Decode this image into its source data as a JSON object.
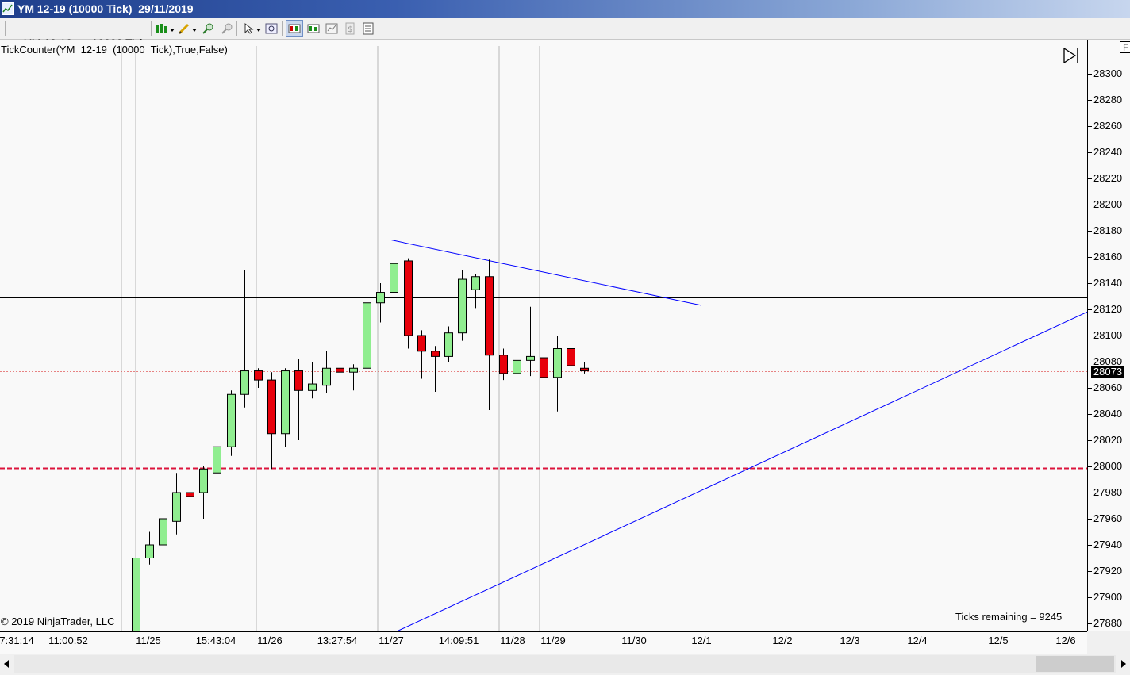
{
  "window": {
    "title": "YM 12-19 (10000 Tick)  29/11/2019"
  },
  "toolbar": {
    "instrument": "YM 12-19",
    "interval": "10000 Tick",
    "icons": [
      "bar-style-icon",
      "drawing-pencil-icon",
      "zoom-in-icon",
      "zoom-out-icon",
      "pointer-icon",
      "magnifier-icon",
      "chart-trader-icon",
      "strategies-icon",
      "data-box-icon",
      "dollar-icon",
      "properties-icon"
    ]
  },
  "chart": {
    "indicator_label": "TickCounter(YM  12-19  (10000  Tick),True,False)",
    "copyright": "© 2019 NinjaTrader, LLC",
    "ticks_remaining": "Ticks remaining = 9245",
    "last_price_label": "28073",
    "flag_label": "F",
    "colors": {
      "up": "#90ee90",
      "down": "#e8000b",
      "trendline": "#0000ff",
      "level": "#dc143c",
      "background": "#f9f9f9"
    }
  },
  "chart_data": {
    "type": "candlestick",
    "instrument": "YM 12-19",
    "bar_type": "10000 Tick",
    "price_axis": {
      "min": 27880,
      "max": 28300,
      "step": 20,
      "labels": [
        "28300",
        "28280",
        "28260",
        "28240",
        "28220",
        "28200",
        "28180",
        "28160",
        "28140",
        "28120",
        "28100",
        "28080",
        "28060",
        "28040",
        "28020",
        "28000",
        "27980",
        "27960",
        "27940",
        "27920",
        "27900",
        "27880"
      ]
    },
    "time_axis_labels": [
      "7:31:14",
      "11:00:52",
      "11/25",
      "15:43:04",
      "11/26",
      "13:27:54",
      "11/27",
      "14:09:51",
      "11/28",
      "11/29",
      "11/30",
      "12/1",
      "12/2",
      "12/3",
      "12/4",
      "12/5",
      "12/6"
    ],
    "last_price": 28073,
    "horizontal_lines": [
      {
        "price": 28129,
        "style": "solid",
        "color": "#000000"
      },
      {
        "price": 27999,
        "style": "dashed",
        "color": "#dc143c"
      }
    ],
    "candles": [
      {
        "open": 27820,
        "high": 27955,
        "low": 27820,
        "close": 27930
      },
      {
        "open": 27930,
        "high": 27950,
        "low": 27925,
        "close": 27940
      },
      {
        "open": 27940,
        "high": 27960,
        "low": 27918,
        "close": 27960
      },
      {
        "open": 27958,
        "high": 27995,
        "low": 27948,
        "close": 27980
      },
      {
        "open": 27980,
        "high": 28005,
        "low": 27970,
        "close": 27977
      },
      {
        "open": 27980,
        "high": 28000,
        "low": 27960,
        "close": 27998
      },
      {
        "open": 27995,
        "high": 28032,
        "low": 27990,
        "close": 28015
      },
      {
        "open": 28015,
        "high": 28058,
        "low": 28008,
        "close": 28055
      },
      {
        "open": 28055,
        "high": 28150,
        "low": 28045,
        "close": 28073
      },
      {
        "open": 28073,
        "high": 28075,
        "low": 28060,
        "close": 28066
      },
      {
        "open": 28066,
        "high": 28072,
        "low": 27998,
        "close": 28025
      },
      {
        "open": 28025,
        "high": 28075,
        "low": 28015,
        "close": 28073
      },
      {
        "open": 28073,
        "high": 28082,
        "low": 28020,
        "close": 28058
      },
      {
        "open": 28058,
        "high": 28080,
        "low": 28052,
        "close": 28063
      },
      {
        "open": 28062,
        "high": 28088,
        "low": 28056,
        "close": 28075
      },
      {
        "open": 28075,
        "high": 28104,
        "low": 28068,
        "close": 28072
      },
      {
        "open": 28072,
        "high": 28078,
        "low": 28058,
        "close": 28075
      },
      {
        "open": 28075,
        "high": 28124,
        "low": 28068,
        "close": 28125
      },
      {
        "open": 28125,
        "high": 28140,
        "low": 28110,
        "close": 28133
      },
      {
        "open": 28133,
        "high": 28173,
        "low": 28120,
        "close": 28155
      },
      {
        "open": 28157,
        "high": 28159,
        "low": 28090,
        "close": 28100
      },
      {
        "open": 28100,
        "high": 28104,
        "low": 28067,
        "close": 28088
      },
      {
        "open": 28088,
        "high": 28092,
        "low": 28057,
        "close": 28084
      },
      {
        "open": 28084,
        "high": 28107,
        "low": 28080,
        "close": 28102
      },
      {
        "open": 28102,
        "high": 28150,
        "low": 28096,
        "close": 28143
      },
      {
        "open": 28135,
        "high": 28147,
        "low": 28121,
        "close": 28145
      },
      {
        "open": 28145,
        "high": 28158,
        "low": 28043,
        "close": 28085
      },
      {
        "open": 28085,
        "high": 28090,
        "low": 28066,
        "close": 28071
      },
      {
        "open": 28071,
        "high": 28090,
        "low": 28044,
        "close": 28081
      },
      {
        "open": 28081,
        "high": 28122,
        "low": 28069,
        "close": 28084
      },
      {
        "open": 28083,
        "high": 28093,
        "low": 28065,
        "close": 28068
      },
      {
        "open": 28068,
        "high": 28100,
        "low": 28042,
        "close": 28090
      },
      {
        "open": 28090,
        "high": 28111,
        "low": 28070,
        "close": 28077
      },
      {
        "open": 28075,
        "high": 28080,
        "low": 28071,
        "close": 28073
      }
    ]
  }
}
